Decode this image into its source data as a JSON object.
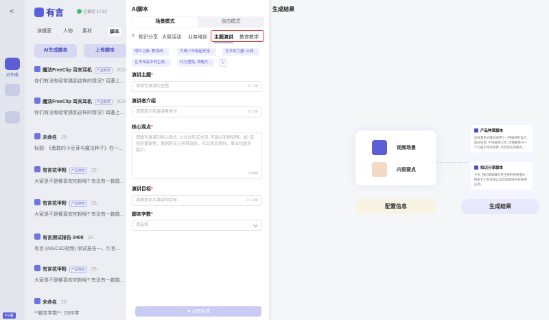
{
  "app": {
    "logo": "有言",
    "status": "已保存 17:32"
  },
  "rail": {
    "active_label": "对作成",
    "version": "Pro版"
  },
  "background": {
    "tabs": [
      "演播室",
      "人物",
      "素材",
      "脚本"
    ],
    "ai_button": "AI生成脚本",
    "upload_button": "上传脚本",
    "list": [
      {
        "title": "魔法FreeClip 耳夹耳机",
        "tag": "产品种草",
        "date": "2024",
        "text": "你们有没有经常遇到这样的情况? 耳塞上..."
      },
      {
        "title": "魔法FreeClip 耳夹耳机",
        "tag": "产品种草",
        "date": "2024",
        "text": "你们有没有经常遇到这样的情况? 耳塞上..."
      },
      {
        "title": "未命名",
        "tag": "",
        "date": "25-",
        "text": "标题: 《勇敢的小豆芽与魔法种子》在一..."
      },
      {
        "title": "有言花甲粉",
        "tag": "产品种草",
        "date": "25-",
        "text": "大家是不是都喜欢吃粉呢? 有没有一款能..."
      },
      {
        "title": "有言花甲粉",
        "tag": "产品种草",
        "date": "25-",
        "text": "大家是不是都喜欢吃粉呢? 有没有一款能..."
      },
      {
        "title": "有言测试报告 0409",
        "tag": "",
        "date": "25-",
        "text": "有言 (AIGC3D视频) 测试报告一、引言..."
      },
      {
        "title": "有言花甲粉",
        "tag": "产品种草",
        "date": "25-",
        "text": "大家是不是都喜欢吃粉呢? 有没有一款能..."
      },
      {
        "title": "未命名",
        "tag": "",
        "date": "25-",
        "text": "**脚本字数**: 1500字"
      }
    ]
  },
  "panel": {
    "title": "AI脚本",
    "modes": [
      "场景模式",
      "自由模式"
    ],
    "categories": [
      "知识分享",
      "大型活动",
      "业务培训",
      "主题演讲",
      "教育教学"
    ],
    "selected_category": "主题演讲",
    "chips": [
      "明日之新: 教育改...",
      "为青少年筑起安全...",
      "艺术的力量: 从政...",
      "艺术作品中的生成...",
      "行万里路, 领略文..."
    ],
    "fields": {
      "topic": {
        "label": "演讲主题",
        "placeholder": "请填写演讲的主题",
        "count": "0 / 50"
      },
      "speaker": {
        "label": "演讲者介绍",
        "placeholder": "请简单介绍演讲者身份",
        "count": "0 / 50"
      },
      "points": {
        "label": "核心观点",
        "placeholder": "请填写演讲的核心观点, 以分点形式呈现, 可辅以实例说明。如: 自信的重要性、案例是自己获得自信、社交状态更好、事业也越来越上。",
        "count": "0/500"
      },
      "goal": {
        "label": "演讲目标",
        "placeholder": "请描述本次演讲的目标",
        "count": "0 / 100"
      },
      "length": {
        "label": "脚本字数",
        "placeholder": "请选择"
      }
    },
    "generate_button": "立即生成"
  },
  "result": {
    "title": "生成结果",
    "illustration_items": [
      "视频场景",
      "内容要点"
    ],
    "config_label": "配置信息",
    "cards": [
      {
        "title": "产品种草脚本",
        "body": "这款耳夹式耳机采用了一种独特的设计, 既舒适稳, 不怕掉落之忧, 仿佛戴像十一个只属于你的世界, 尽享音乐的魅力。"
      },
      {
        "title": "知识分享脚本",
        "body": "今天, 我们来聊聊外星生物的神秘面纱, 探索它们在地球以及其他星球中的各种应用。"
      }
    ],
    "result_label": "生成结果"
  }
}
